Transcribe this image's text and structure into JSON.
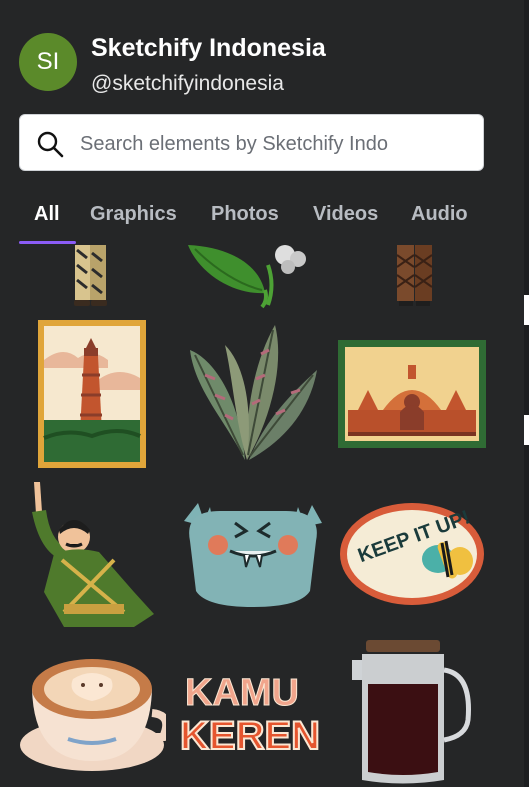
{
  "brand": {
    "initials": "SI",
    "name": "Sketchify Indonesia",
    "handle": "@sketchifyindonesia",
    "avatar_color": "#5b8a2a"
  },
  "search": {
    "placeholder": "Search elements by Sketchify Indo",
    "value": ""
  },
  "tabs": [
    {
      "label": "All",
      "active": true
    },
    {
      "label": "Graphics",
      "active": false
    },
    {
      "label": "Photos",
      "active": false
    },
    {
      "label": "Videos",
      "active": false
    },
    {
      "label": "Audio",
      "active": false
    }
  ],
  "accent_color": "#8b5cf6",
  "graphics": [
    {
      "name": "batik-figure-legs"
    },
    {
      "name": "green-leaf-flower"
    },
    {
      "name": "batik-legs-brown"
    },
    {
      "name": "lighthouse-stamp"
    },
    {
      "name": "tropical-leaves"
    },
    {
      "name": "borobudur-stamp"
    },
    {
      "name": "pointing-soldier"
    },
    {
      "name": "blue-monster"
    },
    {
      "name": "keep-it-up-sticker",
      "text": "KEEP IT UP!"
    },
    {
      "name": "latte-cup"
    },
    {
      "name": "kamu-keren-text",
      "line1": "KAMU",
      "line2": "KEREN"
    },
    {
      "name": "french-press-coffee"
    }
  ]
}
